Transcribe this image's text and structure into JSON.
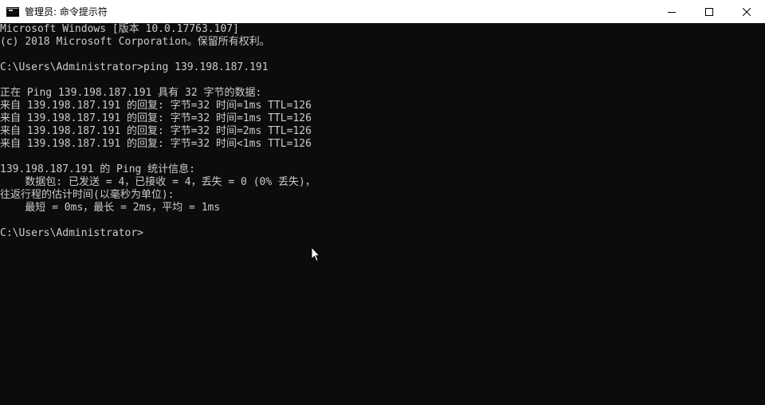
{
  "window": {
    "title": "管理员: 命令提示符",
    "icon": "cmd-icon",
    "controls": [
      "minimize-icon",
      "maximize-icon",
      "close-icon"
    ]
  },
  "console": {
    "lines": [
      "Microsoft Windows [版本 10.0.17763.107]",
      "(c) 2018 Microsoft Corporation。保留所有权利。",
      "",
      "C:\\Users\\Administrator>ping 139.198.187.191",
      "",
      "正在 Ping 139.198.187.191 具有 32 字节的数据:",
      "来自 139.198.187.191 的回复: 字节=32 时间=1ms TTL=126",
      "来自 139.198.187.191 的回复: 字节=32 时间=1ms TTL=126",
      "来自 139.198.187.191 的回复: 字节=32 时间=2ms TTL=126",
      "来自 139.198.187.191 的回复: 字节=32 时间<1ms TTL=126",
      "",
      "139.198.187.191 的 Ping 统计信息:",
      "    数据包: 已发送 = 4，已接收 = 4，丢失 = 0 (0% 丢失)，",
      "往返行程的估计时间(以毫秒为单位):",
      "    最短 = 0ms，最长 = 2ms，平均 = 1ms",
      "",
      "C:\\Users\\Administrator>"
    ]
  },
  "colors": {
    "background": "#0c0c0c",
    "text": "#cccccc",
    "titlebar": "#ffffff"
  },
  "pointer": "mouse-pointer-icon"
}
